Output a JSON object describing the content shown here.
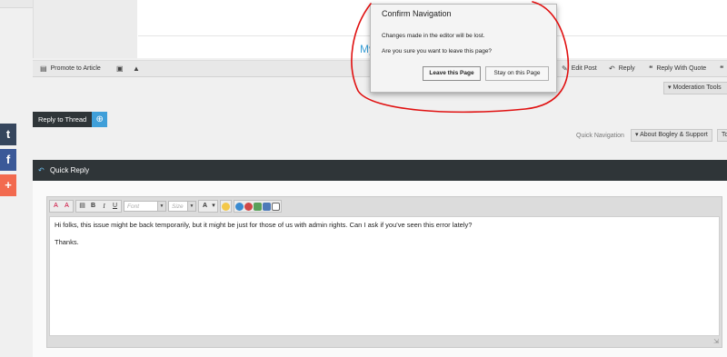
{
  "post": {
    "title_fragment": "My",
    "actions_left": {
      "promote": "Promote to Article"
    },
    "actions_right": {
      "edit": "Edit Post",
      "reply": "Reply",
      "reply_quote": "Reply With Quote"
    }
  },
  "moderation_tools": "Moderation Tools",
  "reply_to_thread": "Reply to Thread",
  "quick_navigation": {
    "label": "Quick Navigation",
    "button": "About Bogley & Support",
    "button2": "To"
  },
  "social": {
    "tumblr": "t",
    "facebook": "f",
    "plus": "+"
  },
  "quick_reply": {
    "title": "Quick Reply"
  },
  "editor": {
    "font_placeholder": "Font",
    "size_placeholder": "Size",
    "paragraphs": [
      "Hi folks, this issue might be back temporarily, but it might be just for those of us with admin rights.  Can I ask if you've seen this error lately?",
      "Thanks."
    ]
  },
  "dialog": {
    "title": "Confirm Navigation",
    "message": "Changes made in the editor will be lost.",
    "question": "Are you sure you want to leave this page?",
    "leave_button": "Leave this Page",
    "stay_button": "Stay on this Page"
  },
  "colors": {
    "dark_bar": "#2f3538",
    "accent_blue": "#3f9fd9",
    "annotation_red": "#e01010"
  }
}
